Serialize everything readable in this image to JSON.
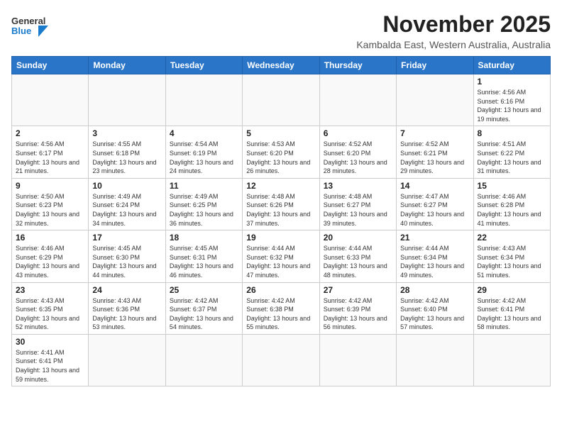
{
  "header": {
    "logo_general": "General",
    "logo_blue": "Blue",
    "month": "November 2025",
    "location": "Kambalda East, Western Australia, Australia"
  },
  "days_of_week": [
    "Sunday",
    "Monday",
    "Tuesday",
    "Wednesday",
    "Thursday",
    "Friday",
    "Saturday"
  ],
  "weeks": [
    {
      "days": [
        {
          "date": "",
          "empty": true
        },
        {
          "date": "",
          "empty": true
        },
        {
          "date": "",
          "empty": true
        },
        {
          "date": "",
          "empty": true
        },
        {
          "date": "",
          "empty": true
        },
        {
          "date": "",
          "empty": true
        },
        {
          "date": "1",
          "sunrise": "Sunrise: 4:56 AM",
          "sunset": "Sunset: 6:16 PM",
          "daylight": "Daylight: 13 hours and 19 minutes."
        }
      ]
    },
    {
      "days": [
        {
          "date": "2",
          "sunrise": "Sunrise: 4:56 AM",
          "sunset": "Sunset: 6:17 PM",
          "daylight": "Daylight: 13 hours and 21 minutes."
        },
        {
          "date": "3",
          "sunrise": "Sunrise: 4:55 AM",
          "sunset": "Sunset: 6:18 PM",
          "daylight": "Daylight: 13 hours and 23 minutes."
        },
        {
          "date": "4",
          "sunrise": "Sunrise: 4:54 AM",
          "sunset": "Sunset: 6:19 PM",
          "daylight": "Daylight: 13 hours and 24 minutes."
        },
        {
          "date": "5",
          "sunrise": "Sunrise: 4:53 AM",
          "sunset": "Sunset: 6:20 PM",
          "daylight": "Daylight: 13 hours and 26 minutes."
        },
        {
          "date": "6",
          "sunrise": "Sunrise: 4:52 AM",
          "sunset": "Sunset: 6:20 PM",
          "daylight": "Daylight: 13 hours and 28 minutes."
        },
        {
          "date": "7",
          "sunrise": "Sunrise: 4:52 AM",
          "sunset": "Sunset: 6:21 PM",
          "daylight": "Daylight: 13 hours and 29 minutes."
        },
        {
          "date": "8",
          "sunrise": "Sunrise: 4:51 AM",
          "sunset": "Sunset: 6:22 PM",
          "daylight": "Daylight: 13 hours and 31 minutes."
        }
      ]
    },
    {
      "days": [
        {
          "date": "9",
          "sunrise": "Sunrise: 4:50 AM",
          "sunset": "Sunset: 6:23 PM",
          "daylight": "Daylight: 13 hours and 32 minutes."
        },
        {
          "date": "10",
          "sunrise": "Sunrise: 4:49 AM",
          "sunset": "Sunset: 6:24 PM",
          "daylight": "Daylight: 13 hours and 34 minutes."
        },
        {
          "date": "11",
          "sunrise": "Sunrise: 4:49 AM",
          "sunset": "Sunset: 6:25 PM",
          "daylight": "Daylight: 13 hours and 36 minutes."
        },
        {
          "date": "12",
          "sunrise": "Sunrise: 4:48 AM",
          "sunset": "Sunset: 6:26 PM",
          "daylight": "Daylight: 13 hours and 37 minutes."
        },
        {
          "date": "13",
          "sunrise": "Sunrise: 4:48 AM",
          "sunset": "Sunset: 6:27 PM",
          "daylight": "Daylight: 13 hours and 39 minutes."
        },
        {
          "date": "14",
          "sunrise": "Sunrise: 4:47 AM",
          "sunset": "Sunset: 6:27 PM",
          "daylight": "Daylight: 13 hours and 40 minutes."
        },
        {
          "date": "15",
          "sunrise": "Sunrise: 4:46 AM",
          "sunset": "Sunset: 6:28 PM",
          "daylight": "Daylight: 13 hours and 41 minutes."
        }
      ]
    },
    {
      "days": [
        {
          "date": "16",
          "sunrise": "Sunrise: 4:46 AM",
          "sunset": "Sunset: 6:29 PM",
          "daylight": "Daylight: 13 hours and 43 minutes."
        },
        {
          "date": "17",
          "sunrise": "Sunrise: 4:45 AM",
          "sunset": "Sunset: 6:30 PM",
          "daylight": "Daylight: 13 hours and 44 minutes."
        },
        {
          "date": "18",
          "sunrise": "Sunrise: 4:45 AM",
          "sunset": "Sunset: 6:31 PM",
          "daylight": "Daylight: 13 hours and 46 minutes."
        },
        {
          "date": "19",
          "sunrise": "Sunrise: 4:44 AM",
          "sunset": "Sunset: 6:32 PM",
          "daylight": "Daylight: 13 hours and 47 minutes."
        },
        {
          "date": "20",
          "sunrise": "Sunrise: 4:44 AM",
          "sunset": "Sunset: 6:33 PM",
          "daylight": "Daylight: 13 hours and 48 minutes."
        },
        {
          "date": "21",
          "sunrise": "Sunrise: 4:44 AM",
          "sunset": "Sunset: 6:34 PM",
          "daylight": "Daylight: 13 hours and 49 minutes."
        },
        {
          "date": "22",
          "sunrise": "Sunrise: 4:43 AM",
          "sunset": "Sunset: 6:34 PM",
          "daylight": "Daylight: 13 hours and 51 minutes."
        }
      ]
    },
    {
      "days": [
        {
          "date": "23",
          "sunrise": "Sunrise: 4:43 AM",
          "sunset": "Sunset: 6:35 PM",
          "daylight": "Daylight: 13 hours and 52 minutes."
        },
        {
          "date": "24",
          "sunrise": "Sunrise: 4:43 AM",
          "sunset": "Sunset: 6:36 PM",
          "daylight": "Daylight: 13 hours and 53 minutes."
        },
        {
          "date": "25",
          "sunrise": "Sunrise: 4:42 AM",
          "sunset": "Sunset: 6:37 PM",
          "daylight": "Daylight: 13 hours and 54 minutes."
        },
        {
          "date": "26",
          "sunrise": "Sunrise: 4:42 AM",
          "sunset": "Sunset: 6:38 PM",
          "daylight": "Daylight: 13 hours and 55 minutes."
        },
        {
          "date": "27",
          "sunrise": "Sunrise: 4:42 AM",
          "sunset": "Sunset: 6:39 PM",
          "daylight": "Daylight: 13 hours and 56 minutes."
        },
        {
          "date": "28",
          "sunrise": "Sunrise: 4:42 AM",
          "sunset": "Sunset: 6:40 PM",
          "daylight": "Daylight: 13 hours and 57 minutes."
        },
        {
          "date": "29",
          "sunrise": "Sunrise: 4:42 AM",
          "sunset": "Sunset: 6:41 PM",
          "daylight": "Daylight: 13 hours and 58 minutes."
        }
      ]
    },
    {
      "days": [
        {
          "date": "30",
          "sunrise": "Sunrise: 4:41 AM",
          "sunset": "Sunset: 6:41 PM",
          "daylight": "Daylight: 13 hours and 59 minutes."
        },
        {
          "date": "",
          "empty": true
        },
        {
          "date": "",
          "empty": true
        },
        {
          "date": "",
          "empty": true
        },
        {
          "date": "",
          "empty": true
        },
        {
          "date": "",
          "empty": true
        },
        {
          "date": "",
          "empty": true
        }
      ]
    }
  ]
}
